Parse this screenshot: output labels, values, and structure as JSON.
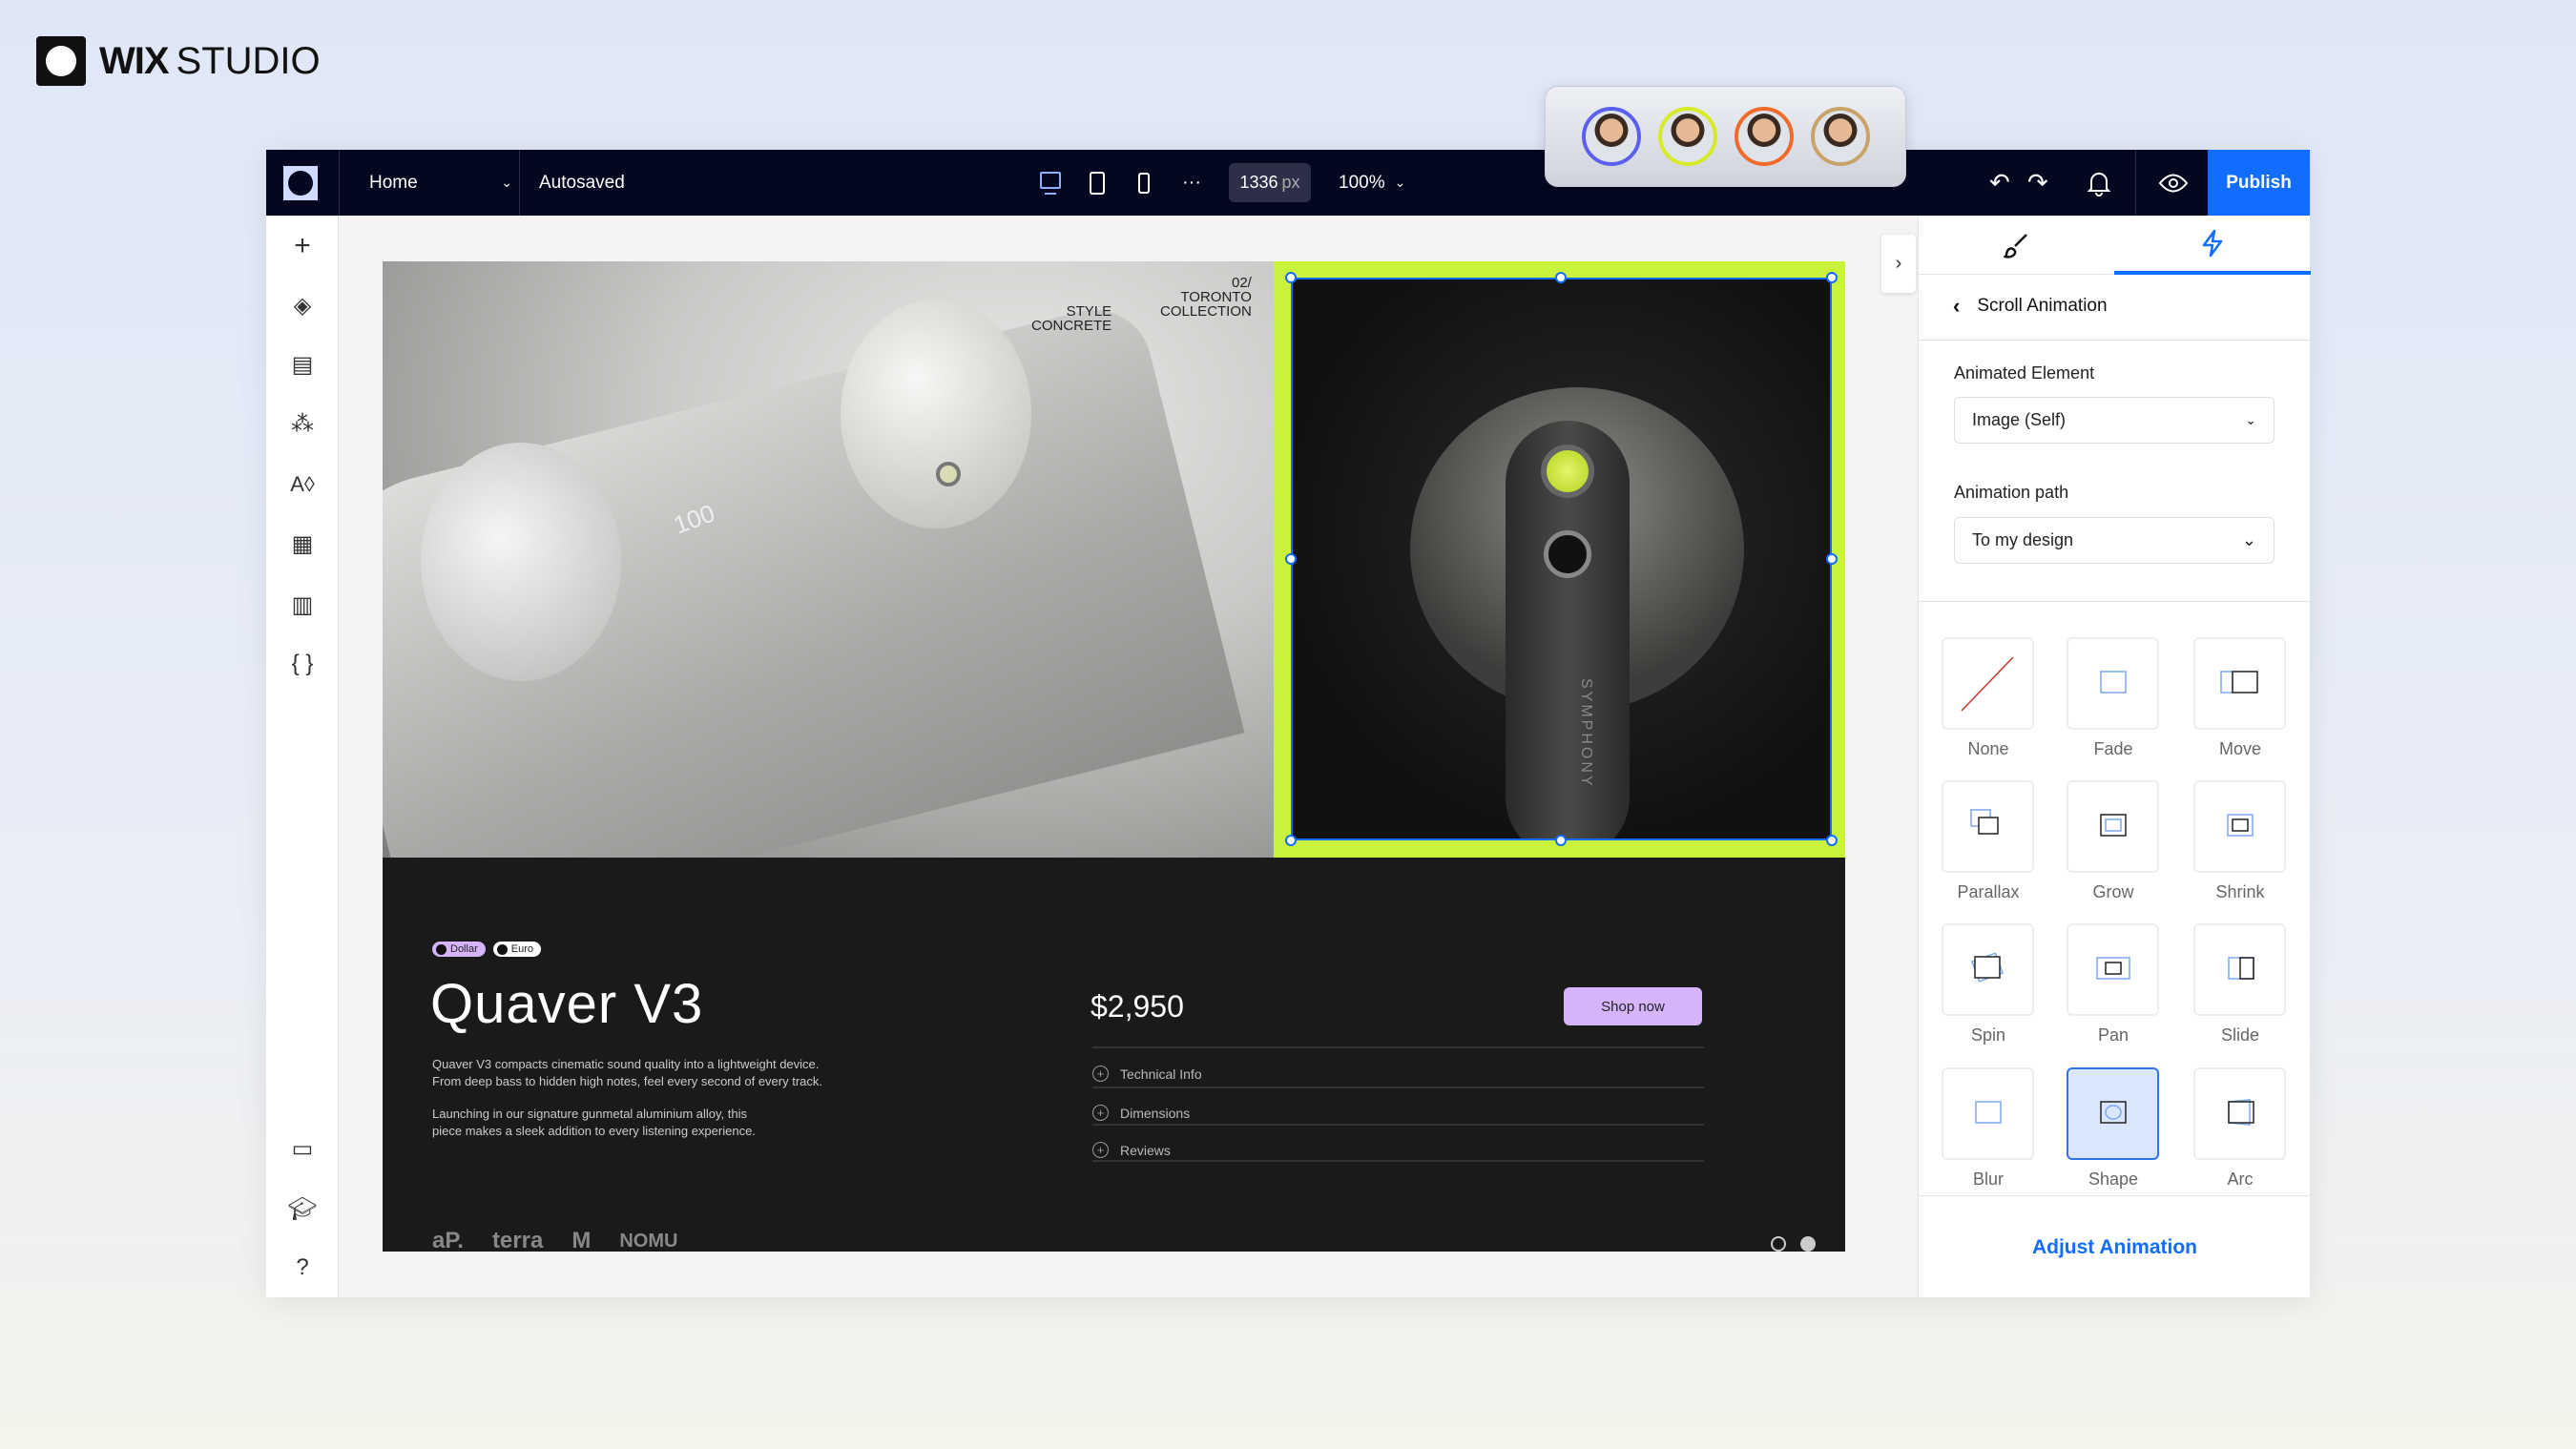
{
  "brand": {
    "wix": "WIX",
    "studio": "STUDIO"
  },
  "topbar": {
    "page": "Home",
    "status": "Autosaved",
    "width_value": "1336",
    "width_unit": "px",
    "zoom": "100%",
    "publish": "Publish"
  },
  "collaborators": [
    {
      "color": "#5b5ff0"
    },
    {
      "color": "#d8e92a"
    },
    {
      "color": "#f06a2c"
    },
    {
      "color": "#c9a36a"
    }
  ],
  "hero": {
    "tag_left_1": "STYLE",
    "tag_left_2": "CONCRETE",
    "tag_right_0": "02/",
    "tag_right_1": "TORONTO",
    "tag_right_2": "COLLECTION",
    "device_text": "SYMPHONY",
    "display_text": "100"
  },
  "product": {
    "currencies": [
      "Dollar",
      "Euro"
    ],
    "title": "Quaver V3",
    "desc1": "Quaver V3 compacts cinematic sound quality into a lightweight device.",
    "desc2": "From deep bass to hidden high notes, feel every second of every track.",
    "desc3": "Launching in our signature gunmetal  aluminium alloy, this",
    "desc4": "piece makes a sleek addition to every listening experience.",
    "price": "$2,950",
    "cta": "Shop now",
    "accordion": [
      "Technical Info",
      "Dimensions",
      "Reviews"
    ],
    "logos": [
      "aP.",
      "terra",
      "M",
      "NOMU"
    ]
  },
  "panel": {
    "title": "Scroll Animation",
    "animated_element_label": "Animated Element",
    "animated_element_value": "Image (Self)",
    "path_label": "Animation path",
    "path_value": "To my design",
    "animations": [
      "None",
      "Fade",
      "Move",
      "Parallax",
      "Grow",
      "Shrink",
      "Spin",
      "Pan",
      "Slide",
      "Blur",
      "Shape",
      "Arc"
    ],
    "selected": "Shape",
    "adjust": "Adjust Animation"
  },
  "colors": {
    "accent": "#116dff",
    "selection": "#c9f23c",
    "cta": "#d6b4fb",
    "topbar": "#040720"
  }
}
